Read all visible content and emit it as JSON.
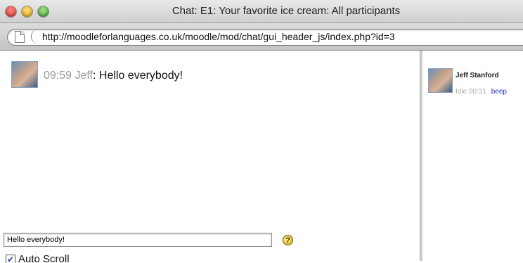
{
  "window": {
    "title": "Chat: E1: Your favorite ice cream: All participants"
  },
  "browser": {
    "url": "http://moodleforlanguages.co.uk/moodle/mod/chat/gui_header_js/index.php?id=3"
  },
  "messages": [
    {
      "time": "09:59",
      "user": "Jeff",
      "separator": ": ",
      "text": "Hello everybody!"
    }
  ],
  "users": [
    {
      "name": "Jeff Stanford",
      "idle": "Idle 00:31",
      "beep": "beep"
    }
  ],
  "input": {
    "value": "Hello everybody!"
  },
  "help": {
    "glyph": "?"
  },
  "autoscroll": {
    "label": "Auto Scroll",
    "checked": true,
    "check_glyph": "✔"
  },
  "colors": {
    "link": "#2233cc",
    "muted": "#9a9a9a"
  }
}
